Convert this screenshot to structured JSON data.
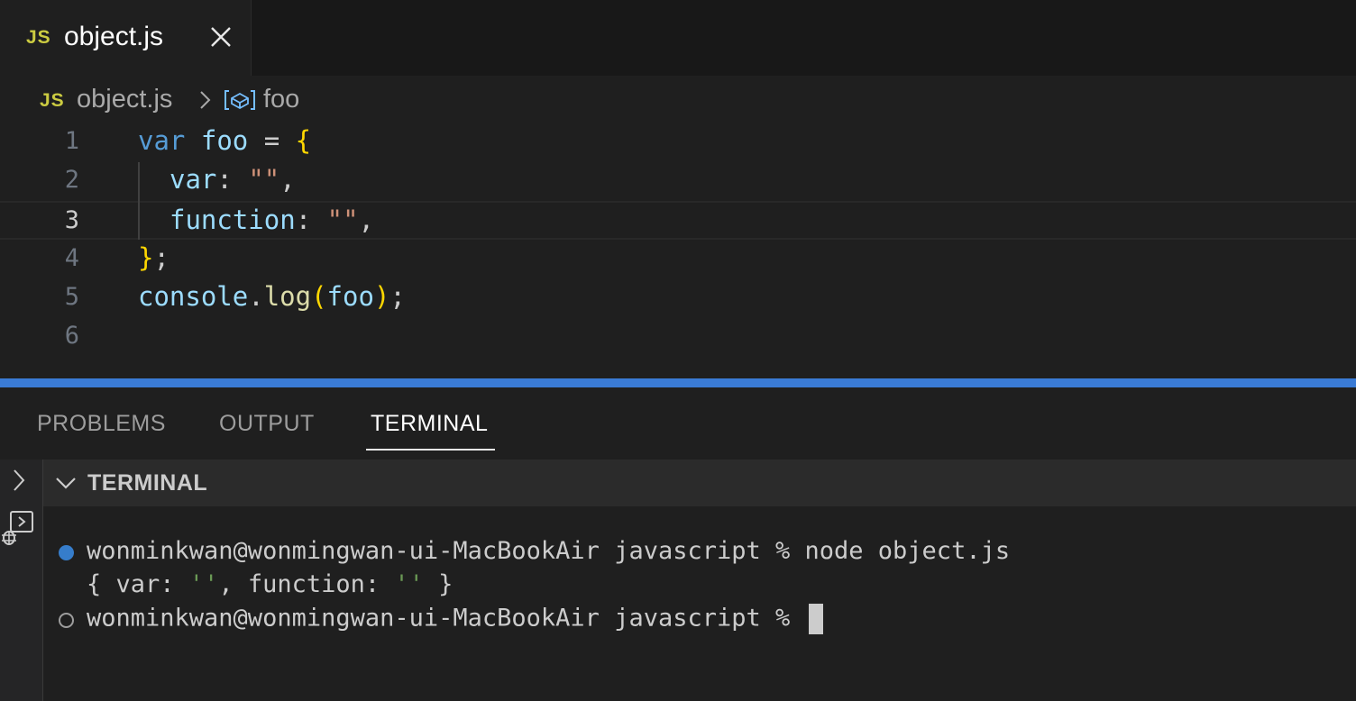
{
  "tab": {
    "badge": "JS",
    "filename": "object.js"
  },
  "breadcrumb": {
    "badge": "JS",
    "file": "object.js",
    "symbol": "foo"
  },
  "editor": {
    "line_numbers": [
      "1",
      "2",
      "3",
      "4",
      "5",
      "6"
    ],
    "active_line": 3,
    "lines": {
      "l1": {
        "kw": "var",
        "name": "foo",
        "eq": " = ",
        "brace": "{"
      },
      "l2": {
        "key": "var",
        "colon": ": ",
        "str": "\"\"",
        "comma": ","
      },
      "l3": {
        "key": "function",
        "colon": ": ",
        "str": "\"\"",
        "comma": ","
      },
      "l4": {
        "brace": "}",
        "semi": ";"
      },
      "l5": {
        "obj": "console",
        "dot": ".",
        "fn": "log",
        "open": "(",
        "arg": "foo",
        "close": ")",
        "semi": ";"
      }
    }
  },
  "panel": {
    "tabs": [
      "PROBLEMS",
      "OUTPUT",
      "TERMINAL"
    ],
    "active_tab": "TERMINAL",
    "section_title": "TERMINAL"
  },
  "terminal": {
    "lines": [
      "wonminkwan@wonmingwan-ui-MacBookAir javascript % node object.js",
      "{ var: '', function: '' }",
      "wonminkwan@wonmingwan-ui-MacBookAir javascript % "
    ]
  },
  "colors": {
    "accent": "#3a7bd5",
    "js_badge": "#cbcb41",
    "keyword": "#569cd6",
    "string": "#ce9178"
  }
}
